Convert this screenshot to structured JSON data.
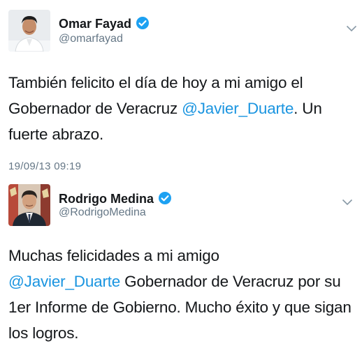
{
  "tweets": [
    {
      "name": "Omar Fayad",
      "handle": "@omarfayad",
      "text_before": "También felicito el día de hoy a mi amigo el Gobernador de Veracruz ",
      "mention": "@Javier_Duarte",
      "text_after": ". Un fuerte abrazo.",
      "timestamp": "19/09/13 09:19",
      "avatar_icon": "profile-photo-icon"
    },
    {
      "name": "Rodrigo Medina",
      "handle": "@RodrigoMedina",
      "text_before": "Muchas felicidades a mi amigo",
      "mention": "@Javier_Duarte",
      "text_after": " Gobernador de Veracruz por su 1er Informe de Gobierno. Mucho éxito y que sigan los logros.",
      "avatar_icon": "profile-photo-icon"
    }
  ],
  "colors": {
    "link": "#1b95e0",
    "verified": "#1da1f2",
    "secondary_text": "#657786"
  }
}
